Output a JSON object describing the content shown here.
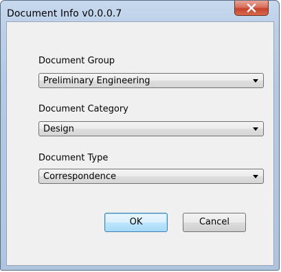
{
  "window": {
    "title": "Document Info v0.0.0.7"
  },
  "icons": {
    "close": "close-icon",
    "dropdown": "chevron-down-icon"
  },
  "fields": {
    "group": {
      "label": "Document Group",
      "value": "Preliminary Engineering"
    },
    "category": {
      "label": "Document Category",
      "value": "Design"
    },
    "type": {
      "label": "Document Type",
      "value": "Correspondence"
    }
  },
  "buttons": {
    "ok": "OK",
    "cancel": "Cancel"
  },
  "colors": {
    "close_button": "#c7432c",
    "default_button_border": "#3c7fb1",
    "client_background": "#f0f0f0"
  }
}
